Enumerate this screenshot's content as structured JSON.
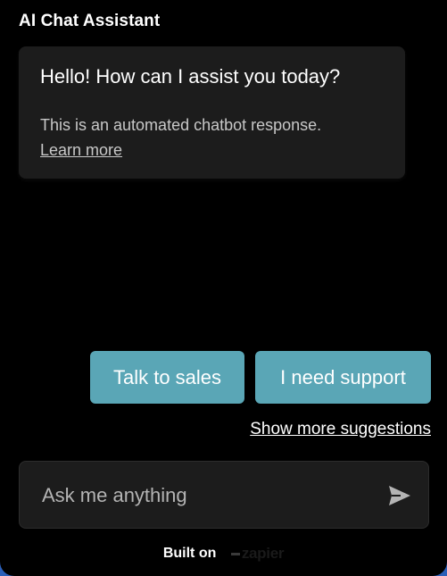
{
  "header": {
    "title": "AI Chat Assistant"
  },
  "bot_message": {
    "greeting": "Hello! How can I assist you today?",
    "note": "This is an automated chatbot response.",
    "learn_more": "Learn more"
  },
  "suggestions": {
    "items": [
      {
        "label": "Talk to sales"
      },
      {
        "label": "I need support"
      }
    ],
    "show_more": "Show more suggestions"
  },
  "composer": {
    "placeholder": "Ask me anything",
    "value": "",
    "send_icon": "send-icon"
  },
  "footer": {
    "built_on": "Built on",
    "brand": "zapier"
  },
  "colors": {
    "background": "#000000",
    "card": "#1c1c1c",
    "accent": "#5aa6b6",
    "page_edge": "#2b5fb8"
  }
}
